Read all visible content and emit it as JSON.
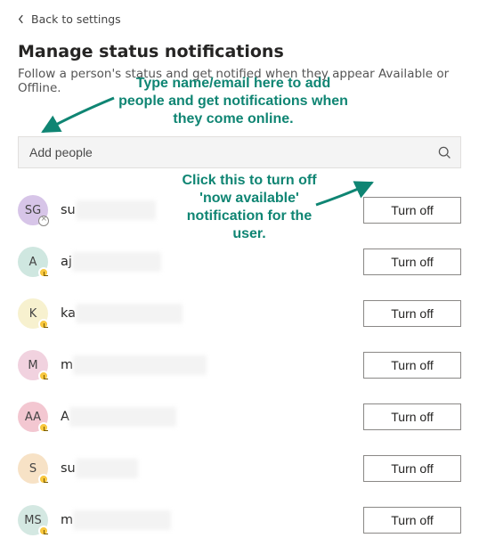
{
  "header": {
    "back_label": "Back to settings",
    "title": "Manage status notifications",
    "subtitle": "Follow a person's status and get notified when they appear Available or Offline."
  },
  "search": {
    "placeholder": "Add people"
  },
  "button_label": "Turn off",
  "people": [
    {
      "initials": "SG",
      "name_fragment": "su",
      "avatar_bg": "#d7c5e8",
      "presence": "offline",
      "blur_w": 90
    },
    {
      "initials": "A",
      "name_fragment": "aj",
      "avatar_bg": "#cfe7e0",
      "presence": "away",
      "blur_w": 100
    },
    {
      "initials": "K",
      "name_fragment": "ka",
      "avatar_bg": "#f7f1cf",
      "presence": "away",
      "blur_w": 120
    },
    {
      "initials": "M",
      "name_fragment": "m",
      "avatar_bg": "#f1d2df",
      "presence": "away",
      "blur_w": 150
    },
    {
      "initials": "AA",
      "name_fragment": "A",
      "avatar_bg": "#f3c7d1",
      "presence": "away",
      "blur_w": 120
    },
    {
      "initials": "S",
      "name_fragment": "su",
      "avatar_bg": "#f7e2c6",
      "presence": "away",
      "blur_w": 70
    },
    {
      "initials": "MS",
      "name_fragment": "m",
      "avatar_bg": "#d4e8e2",
      "presence": "away",
      "blur_w": 110
    }
  ],
  "annotations": {
    "a1": "Type name/email here to add people and get notifications when they come online.",
    "a2": "Click this to turn off 'now available' notification for the user."
  }
}
